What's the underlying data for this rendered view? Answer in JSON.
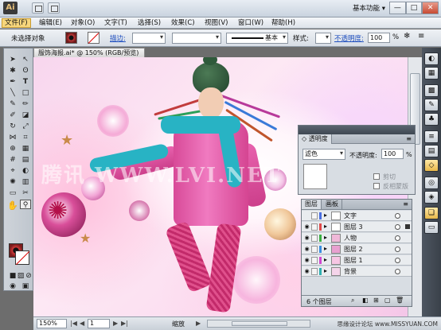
{
  "app": {
    "logo": "Ai",
    "workspace": "基本功能"
  },
  "window_buttons": {
    "minimize": "—",
    "maximize": "□",
    "close": "✕"
  },
  "menu": [
    {
      "label": "文件(F)"
    },
    {
      "label": "编辑(E)"
    },
    {
      "label": "对象(O)"
    },
    {
      "label": "文字(T)"
    },
    {
      "label": "选择(S)"
    },
    {
      "label": "效果(C)"
    },
    {
      "label": "视图(V)"
    },
    {
      "label": "窗口(W)"
    },
    {
      "label": "帮助(H)"
    }
  ],
  "control_bar": {
    "selection_label": "未选择对象",
    "stroke_label": "描边:",
    "brush_label": "基本",
    "style_label": "样式:",
    "opacity_label": "不透明度:",
    "opacity_value": "100",
    "opacity_unit": "%"
  },
  "document": {
    "tab_title": "服饰海报.ai* @ 150% (RGB/预览)"
  },
  "canvas": {
    "watermark": "腾讯 WWW.LVI.NET"
  },
  "transparency_panel": {
    "title": "透明度",
    "blend_mode": "滤色",
    "opacity_label": "不透明度:",
    "opacity_value": "100",
    "opacity_unit": "%",
    "clip_label": "剪切",
    "invert_mask_label": "反相蒙版"
  },
  "layers_panel": {
    "tabs": [
      "图层",
      "画板"
    ],
    "layers": [
      {
        "name": "文字",
        "color": "#4a6ee0"
      },
      {
        "name": "图层 3",
        "color": "#e04a4a"
      },
      {
        "name": "人物",
        "color": "#3cb043"
      },
      {
        "name": "图层 2",
        "color": "#3a8ee0"
      },
      {
        "name": "图层 1",
        "color": "#d048d0"
      },
      {
        "name": "背景",
        "color": "#2fb0b0"
      }
    ],
    "count_text": "6 个图层"
  },
  "status_bar": {
    "zoom": "150%",
    "page": "1",
    "tool_name": "缩放",
    "site": "思缘设计论坛  www.MISSYUAN.COM"
  },
  "icons": {
    "transparency": "transparency-icon",
    "layers": "layers-icon",
    "zoom": "zoom-icon",
    "hand": "hand-icon"
  }
}
